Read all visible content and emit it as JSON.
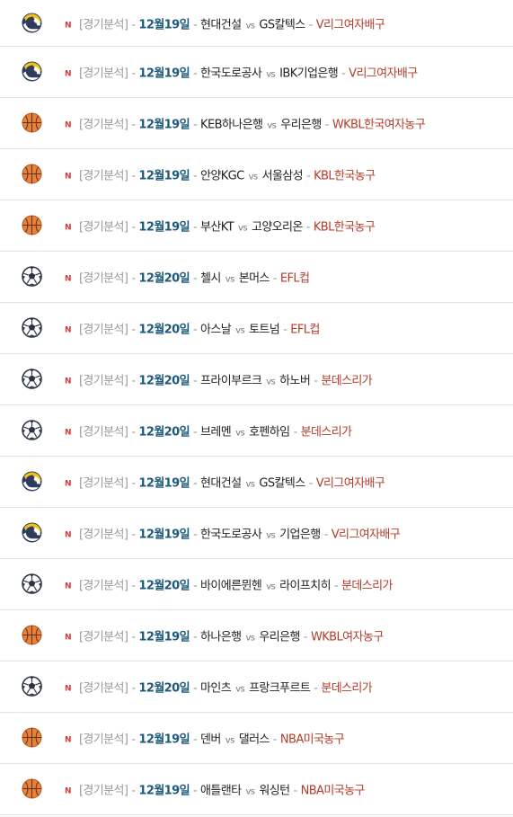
{
  "badge_new": "N",
  "category_label": "[경기분석]",
  "separator": "-",
  "vs_label": "vs",
  "colors": {
    "new": "#d63a3a",
    "date": "#1d5a7a",
    "league": "#b43c2a",
    "category": "#9a9a9a"
  },
  "items": [
    {
      "icon": "volleyball-icon",
      "date": "12월19일",
      "home": "현대건설",
      "away": "GS칼텍스",
      "league": "V리그여자배구"
    },
    {
      "icon": "volleyball-icon",
      "date": "12월19일",
      "home": "한국도로공사",
      "away": "IBK기업은행",
      "league": "V리그여자배구"
    },
    {
      "icon": "basketball-icon",
      "date": "12월19일",
      "home": "KEB하나은행",
      "away": "우리은행",
      "league": "WKBL한국여자농구"
    },
    {
      "icon": "basketball-icon",
      "date": "12월19일",
      "home": "안양KGC",
      "away": "서울삼성",
      "league": "KBL한국농구"
    },
    {
      "icon": "basketball-icon",
      "date": "12월19일",
      "home": "부산KT",
      "away": "고양오리온",
      "league": "KBL한국농구"
    },
    {
      "icon": "soccer-ball-icon",
      "date": "12월20일",
      "home": "첼시",
      "away": "본머스",
      "league": "EFL컵"
    },
    {
      "icon": "soccer-ball-icon",
      "date": "12월20일",
      "home": "아스날",
      "away": "토트넘",
      "league": "EFL컵"
    },
    {
      "icon": "soccer-ball-icon",
      "date": "12월20일",
      "home": "프라이부르크",
      "away": "하노버",
      "league": "분데스리가"
    },
    {
      "icon": "soccer-ball-icon",
      "date": "12월20일",
      "home": "브레멘",
      "away": "호펜하임",
      "league": "분데스리가"
    },
    {
      "icon": "volleyball-icon",
      "date": "12월19일",
      "home": "현대건설",
      "away": "GS칼텍스",
      "league": "V리그여자배구"
    },
    {
      "icon": "volleyball-icon",
      "date": "12월19일",
      "home": "한국도로공사",
      "away": "기업은행",
      "league": "V리그여자배구"
    },
    {
      "icon": "soccer-ball-icon",
      "date": "12월20일",
      "home": "바이에른뮌헨",
      "away": "라이프치히",
      "league": "분데스리가"
    },
    {
      "icon": "basketball-icon",
      "date": "12월19일",
      "home": "하나은행",
      "away": "우리은행",
      "league": "WKBL여자농구"
    },
    {
      "icon": "soccer-ball-icon",
      "date": "12월20일",
      "home": "마인츠",
      "away": "프랑크푸르트",
      "league": "분데스리가"
    },
    {
      "icon": "basketball-icon",
      "date": "12월19일",
      "home": "덴버",
      "away": "댈러스",
      "league": "NBA미국농구"
    },
    {
      "icon": "basketball-icon",
      "date": "12월19일",
      "home": "애틀랜타",
      "away": "워싱턴",
      "league": "NBA미국농구"
    }
  ]
}
